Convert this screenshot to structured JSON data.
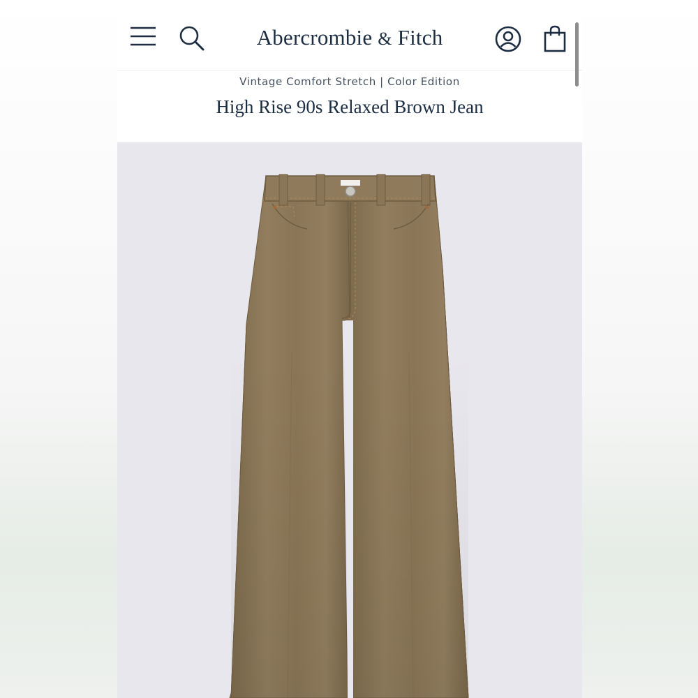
{
  "header": {
    "brand_main": "Abercrombie",
    "brand_amp": "&",
    "brand_tail": "Fitch",
    "icons": [
      "menu-icon",
      "search-icon",
      "account-icon",
      "shopping-bag-icon"
    ]
  },
  "product": {
    "collection": "Vintage Comfort Stretch | Color Edition",
    "title": "High Rise 90s Relaxed Brown Jean",
    "image": "brown-jeans-product-photo"
  },
  "colors": {
    "brand_navy": "#1c2d42",
    "photo_bg": "#e8e7ed",
    "denim_brown": "#8a7656"
  }
}
